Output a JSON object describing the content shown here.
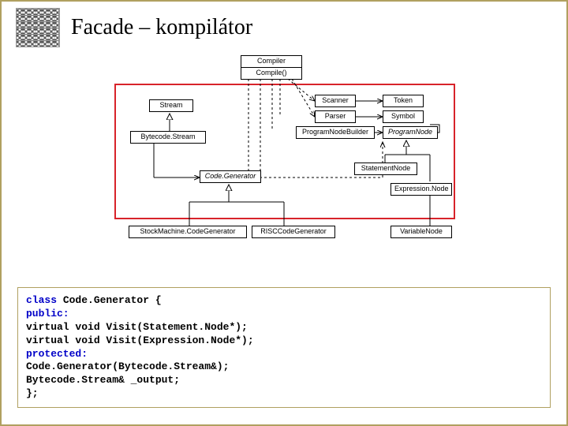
{
  "title": "Facade – kompilátor",
  "uml": {
    "compiler": "Compiler",
    "compiler_op": "Compile()",
    "stream": "Stream",
    "bytecodestream": "Bytecode.Stream",
    "codegen": "Code.Generator",
    "stackgen": "StockMachine.CodeGenerator",
    "riscgen": "RISCCodeGenerator",
    "scanner": "Scanner",
    "parser": "Parser",
    "pnb": "ProgramNodeBuilder",
    "token": "Token",
    "symbol": "Symbol",
    "prognode": "ProgramNode",
    "stmtnode": "StatementNode",
    "exprnode": "Expression.Node",
    "varnode": "VariableNode"
  },
  "code": {
    "l1a": "class",
    "l1b": " Code.Generator {",
    "l2": "public:",
    "l3": "  virtual void Visit(Statement.Node*);",
    "l4": "  virtual void Visit(Expression.Node*);",
    "l5": "protected:",
    "l6": "  Code.Generator(Bytecode.Stream&);",
    "l7": "  Bytecode.Stream& _output;",
    "l8": "};"
  }
}
